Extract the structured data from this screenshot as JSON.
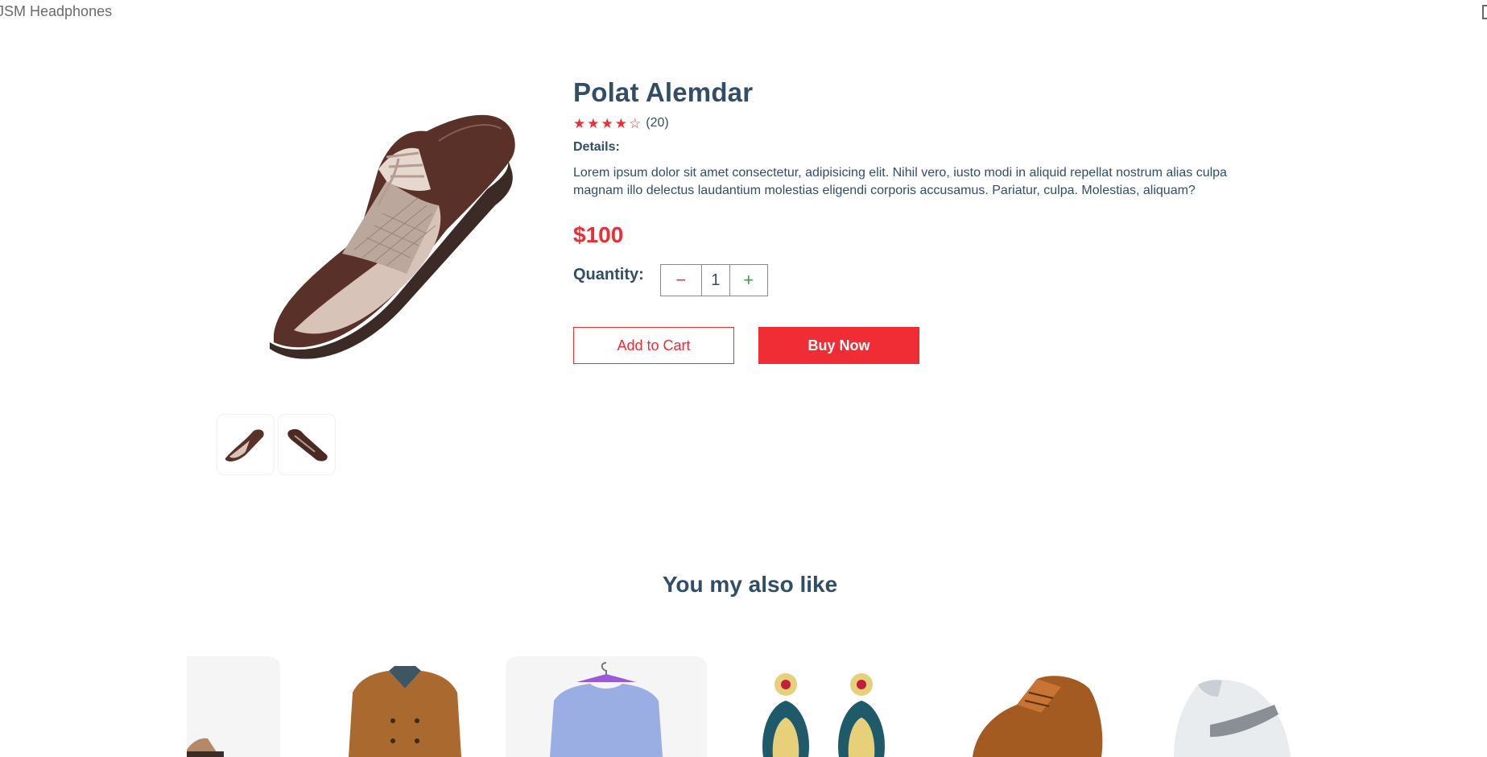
{
  "header": {
    "brand": "JSM Headphones",
    "cart_icon": "cart-icon"
  },
  "product": {
    "title": "Polat Alemdar",
    "rating": {
      "stars_filled": 4,
      "stars_total": 5,
      "reviews": "(20)"
    },
    "details_label": "Details:",
    "details_text": "Lorem ipsum dolor sit amet consectetur, adipisicing elit. Nihil vero, iusto modi in aliquid repellat nostrum alias culpa magnam illo delectus laudantium molestias eligendi corporis accusamus. Pariatur, culpa. Molestias, aliquam?",
    "price": "$100",
    "quantity_label": "Quantity:",
    "quantity_value": "1",
    "minus_symbol": "−",
    "plus_symbol": "+",
    "add_to_cart": "Add to Cart",
    "buy_now": "Buy Now"
  },
  "related": {
    "title": "You my also like",
    "items": [
      {
        "icon": "hat-image"
      },
      {
        "icon": "coat-image"
      },
      {
        "icon": "sweater-image"
      },
      {
        "icon": "earrings-image"
      },
      {
        "icon": "brown-shoe-image"
      },
      {
        "icon": "sneaker-image"
      }
    ]
  },
  "colors": {
    "accent": "#f02d34",
    "text": "#324d67",
    "plus": "#31a831"
  }
}
